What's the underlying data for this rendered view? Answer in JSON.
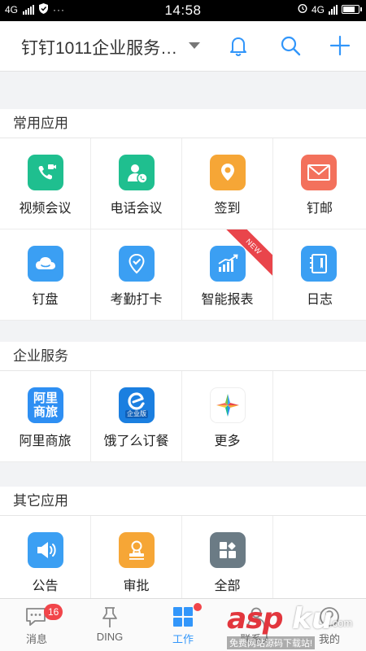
{
  "status_bar": {
    "network_left": "4G",
    "time": "14:58",
    "network_right": "4G"
  },
  "header": {
    "title": "钉钉1011企业服务…",
    "icons": [
      "bell-icon",
      "search-icon",
      "plus-icon"
    ]
  },
  "sections": {
    "common": {
      "title": "常用应用",
      "apps": [
        {
          "label": "视频会议",
          "icon": "video-camera-icon",
          "color": "#1fbf8f"
        },
        {
          "label": "电话会议",
          "icon": "phone-person-icon",
          "color": "#1fbf8f"
        },
        {
          "label": "签到",
          "icon": "location-pin-icon",
          "color": "#f6a636"
        },
        {
          "label": "钉邮",
          "icon": "mail-icon",
          "color": "#f3715c"
        },
        {
          "label": "钉盘",
          "icon": "cloud-icon",
          "color": "#3b9ff3"
        },
        {
          "label": "考勤打卡",
          "icon": "check-pin-icon",
          "color": "#3b9ff3"
        },
        {
          "label": "智能报表",
          "icon": "chart-icon",
          "color": "#3b9ff3",
          "ribbon": "NEW"
        },
        {
          "label": "日志",
          "icon": "notebook-icon",
          "color": "#3b9ff3"
        }
      ]
    },
    "enterprise": {
      "title": "企业服务",
      "apps": [
        {
          "label": "阿里商旅",
          "icon": "alitrip-icon",
          "color": "#2e8ff3",
          "icon_text_1": "阿里",
          "icon_text_2": "商旅"
        },
        {
          "label": "饿了么订餐",
          "icon": "eleme-icon",
          "color": "#1b7fe0",
          "icon_text_1": "企业版"
        },
        {
          "label": "更多",
          "icon": "more-star-icon",
          "color": "#ffffff"
        }
      ]
    },
    "other": {
      "title": "其它应用",
      "apps": [
        {
          "label": "公告",
          "icon": "megaphone-icon",
          "color": "#3b9ff3"
        },
        {
          "label": "审批",
          "icon": "stamp-icon",
          "color": "#f6a636"
        },
        {
          "label": "全部",
          "icon": "grid-all-icon",
          "color": "#6b7b85"
        }
      ]
    }
  },
  "tabbar": {
    "tabs": [
      {
        "label": "消息",
        "icon": "chat-icon",
        "badge": "16"
      },
      {
        "label": "DING",
        "icon": "pin-icon"
      },
      {
        "label": "工作",
        "icon": "work-grid-icon",
        "active": true
      },
      {
        "label": "联系人",
        "icon": "contacts-icon"
      },
      {
        "label": "我的",
        "icon": "me-icon"
      }
    ]
  },
  "watermark": {
    "text_1": "asp",
    "text_2": "ku",
    "text_3": ".com",
    "text_4": "免费网站源码下载站!"
  },
  "colors": {
    "accent": "#3296fa",
    "badge": "#f1454a",
    "ribbon": "#e9454b"
  }
}
